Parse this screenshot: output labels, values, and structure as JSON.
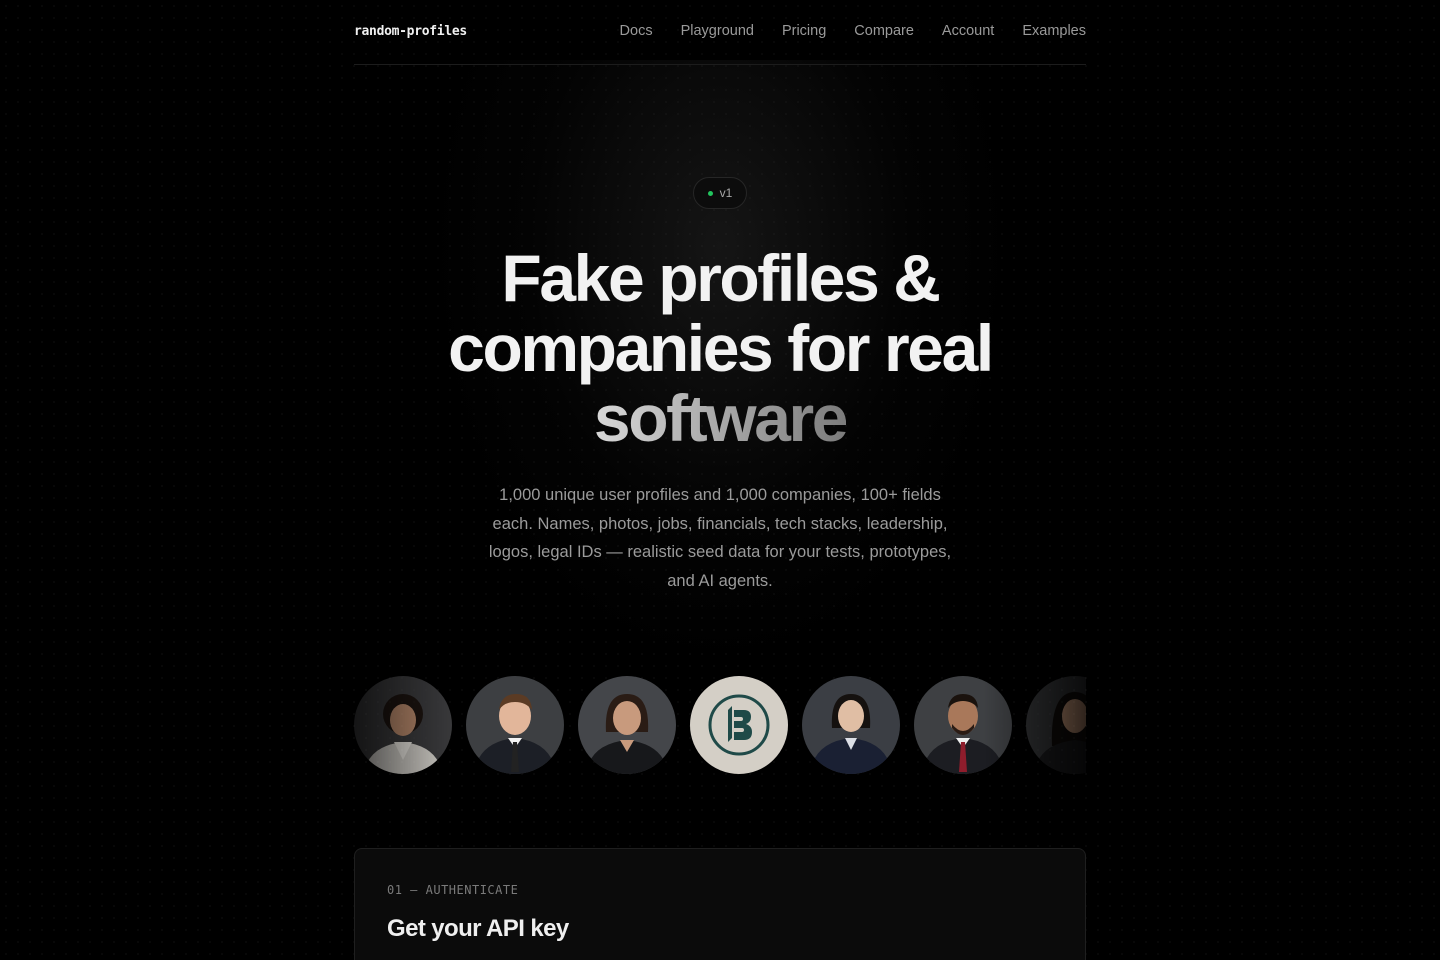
{
  "nav": {
    "brand": "random-profiles",
    "links": [
      "Docs",
      "Playground",
      "Pricing",
      "Compare",
      "Account",
      "Examples"
    ]
  },
  "hero": {
    "badge": "v1",
    "title_main": "Fake profiles & companies for real ",
    "title_fade": "software",
    "subtitle": "1,000 unique user profiles and 1,000 companies, 100+ fields each. Names, photos, jobs, financials, tech stacks, leadership, logos, legal IDs — realistic seed data for your tests, prototypes, and AI agents."
  },
  "avatars": [
    {
      "kind": "person",
      "desc": "woman-light-blazer"
    },
    {
      "kind": "person",
      "desc": "man-suit-tie"
    },
    {
      "kind": "person",
      "desc": "woman-dark-blazer"
    },
    {
      "kind": "logo",
      "desc": "company-logo-b",
      "letter": "B"
    },
    {
      "kind": "person",
      "desc": "woman-navy-suit"
    },
    {
      "kind": "person",
      "desc": "man-red-tie"
    },
    {
      "kind": "person",
      "desc": "woman-dark-hair"
    }
  ],
  "card": {
    "step": "01 — AUTHENTICATE",
    "title": "Get your API key"
  },
  "colors": {
    "background": "#000000",
    "accent_dot": "#22c55e",
    "logo_bg": "#d4cfc6",
    "logo_mark": "#1f4a48"
  }
}
